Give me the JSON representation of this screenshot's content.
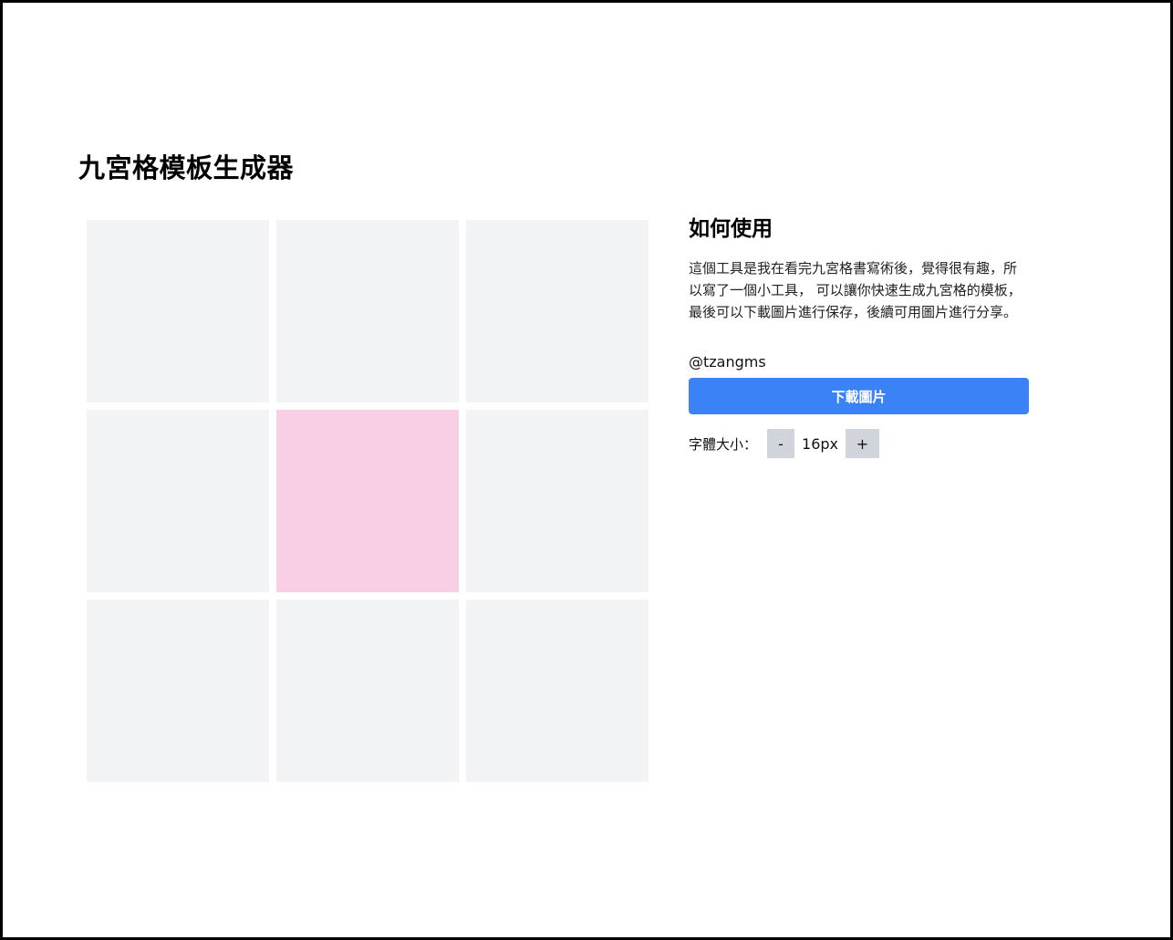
{
  "title": "九宮格模板生成器",
  "grid": {
    "cells": [
      "",
      "",
      "",
      "",
      "",
      "",
      "",
      "",
      ""
    ],
    "highlight_color": "#f9cfe6",
    "cell_color": "#f2f3f5"
  },
  "help": {
    "heading": "如何使用",
    "description": "這個工具是我在看完九宮格書寫術後，覺得很有趣，所以寫了一個小工具， 可以讓你快速生成九宮格的模板，最後可以下載圖片進行保存，後續可用圖片進行分享。",
    "author": "@tzangms"
  },
  "download_button": {
    "label": "下載圖片",
    "color": "#3b82f6"
  },
  "font_size": {
    "label": "字體大小：",
    "value": "16px",
    "decrease_label": "-",
    "increase_label": "+"
  }
}
